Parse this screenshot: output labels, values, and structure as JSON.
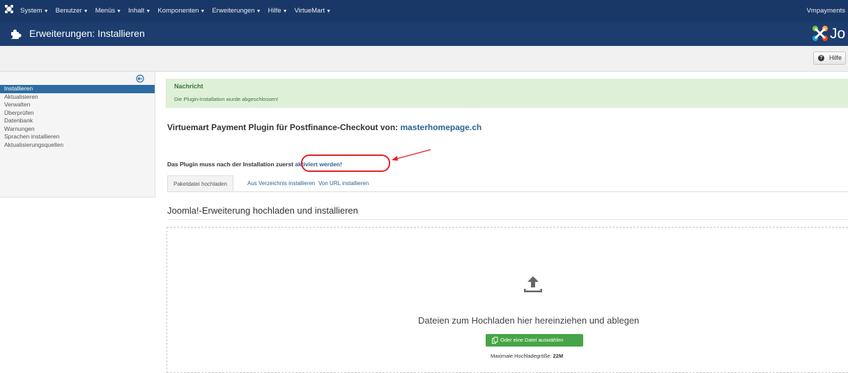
{
  "topbar": {
    "menu": [
      {
        "label": "System"
      },
      {
        "label": "Benutzer"
      },
      {
        "label": "Menüs"
      },
      {
        "label": "Inhalt"
      },
      {
        "label": "Komponenten"
      },
      {
        "label": "Erweiterungen"
      },
      {
        "label": "Hilfe"
      },
      {
        "label": "VirtueMart"
      }
    ],
    "user": "Vmpayments"
  },
  "header": {
    "title": "Erweiterungen: Installieren",
    "brand_text": "Jo"
  },
  "toolbar": {
    "help_label": "Hilfe"
  },
  "sidebar": {
    "items": [
      {
        "label": "Installieren",
        "active": true
      },
      {
        "label": "Aktualisieren"
      },
      {
        "label": "Verwalten"
      },
      {
        "label": "Überprüfen"
      },
      {
        "label": "Datenbank"
      },
      {
        "label": "Warnungen"
      },
      {
        "label": "Sprachen installieren"
      },
      {
        "label": "Aktualisierungsquellen"
      }
    ]
  },
  "message": {
    "heading": "Nachricht",
    "text": "Die Plugin-Installation wurde abgeschlossen!"
  },
  "plugin": {
    "title_prefix": "Virtuemart Payment Plugin für Postfinance-Checkout von: ",
    "title_link": "masterhomepage.ch",
    "note_prefix": "Das Plugin muss nach der Installation zuerst ",
    "note_link": "aktiviert werden!"
  },
  "tabs": [
    {
      "label": "Paketdatei hochladen",
      "active": true
    },
    {
      "label": "Aus Verzeichnis installieren"
    },
    {
      "label": "Von URL installieren"
    }
  ],
  "upload": {
    "section_title": "Joomla!-Erweiterung hochladen und installieren",
    "drop_text": "Dateien zum Hochladen hier hereinziehen und ablegen",
    "choose_button": "Oder eine Datei auswählen",
    "max_size_label": "Maximale Hochladegröße: ",
    "max_size_value": "22M"
  },
  "colors": {
    "topbar": "#1a3867",
    "header": "#1c3d6e",
    "active_sidebar": "#2d6ca2",
    "success_bg": "#dff0d8",
    "success_text": "#3c763d",
    "link": "#2a6496",
    "button_green": "#46a546",
    "annotation_red": "#e12127"
  }
}
